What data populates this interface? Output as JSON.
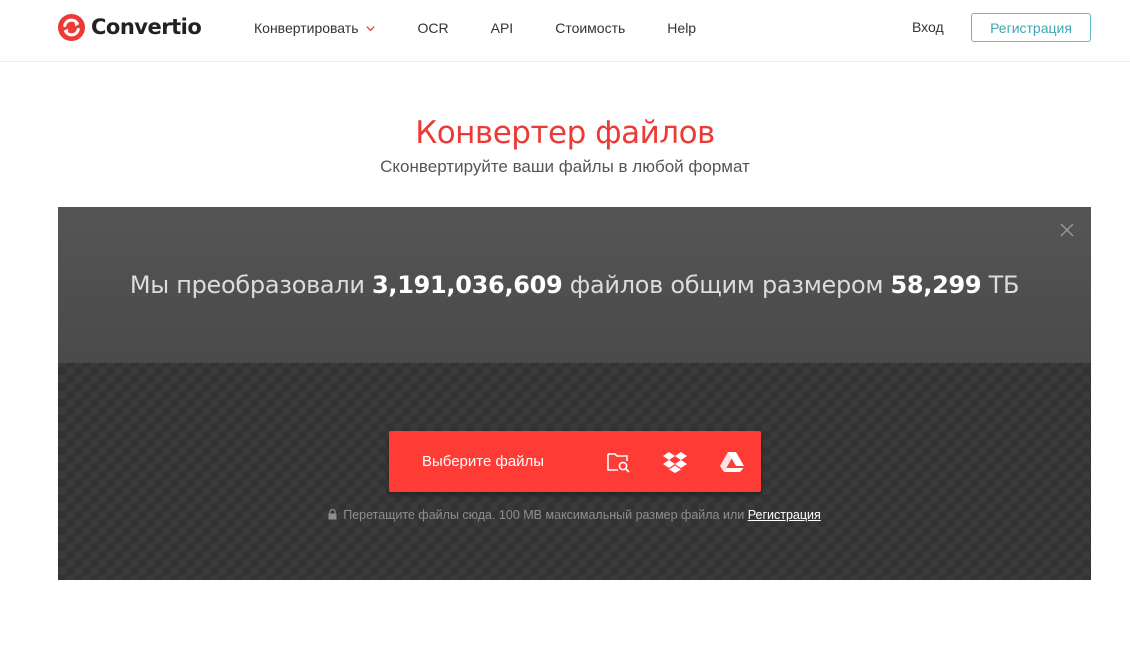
{
  "brand": {
    "name": "Convertio",
    "accent": "#ec3a36"
  },
  "nav": {
    "items": [
      {
        "label": "Конвертировать",
        "has_dropdown": true
      },
      {
        "label": "OCR"
      },
      {
        "label": "API"
      },
      {
        "label": "Стоимость"
      },
      {
        "label": "Help"
      }
    ],
    "login_label": "Вход",
    "signup_label": "Регистрация"
  },
  "hero": {
    "title": "Конвертер файлов",
    "subtitle": "Сконвертируйте ваши файлы в любой формат"
  },
  "stats": {
    "prefix": "Мы преобразовали ",
    "files_count": "3,191,036,609",
    "middle": " файлов общим размером ",
    "total_size": "58,299",
    "unit": " ТБ"
  },
  "upload": {
    "choose_label": "Выберите файлы",
    "icons": [
      "folder-search-icon",
      "dropbox-icon",
      "google-drive-icon"
    ],
    "hint_text": "Перетащите файлы сюда. 100 MB максимальный размер файла или ",
    "hint_link": "Регистрация"
  }
}
